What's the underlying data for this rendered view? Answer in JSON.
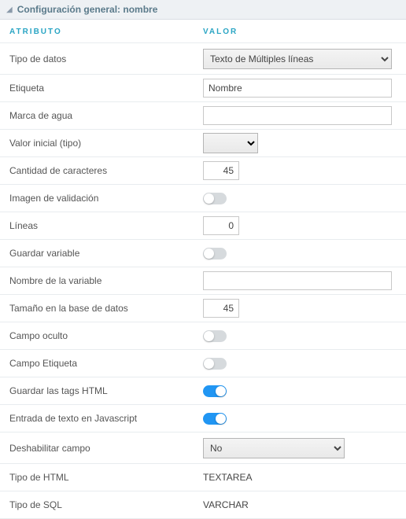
{
  "header": {
    "title": "Configuración general: nombre"
  },
  "columns": {
    "attr": "ATRIBUTO",
    "val": "VALOR"
  },
  "fields": {
    "data_type": {
      "label": "Tipo de datos",
      "value": "Texto de Múltiples líneas"
    },
    "label": {
      "label": "Etiqueta",
      "value": "Nombre"
    },
    "watermark": {
      "label": "Marca de agua",
      "value": ""
    },
    "initial_value": {
      "label": "Valor inicial (tipo)",
      "value": ""
    },
    "char_count": {
      "label": "Cantidad de caracteres",
      "value": "45"
    },
    "validation_img": {
      "label": "Imagen de validación",
      "on": false
    },
    "lines": {
      "label": "Líneas",
      "value": "0"
    },
    "save_var": {
      "label": "Guardar variable",
      "on": false
    },
    "var_name": {
      "label": "Nombre de la variable",
      "value": ""
    },
    "db_size": {
      "label": "Tamaño en la base de datos",
      "value": "45"
    },
    "hidden_field": {
      "label": "Campo oculto",
      "on": false
    },
    "label_field": {
      "label": "Campo Etiqueta",
      "on": false
    },
    "save_html_tags": {
      "label": "Guardar las tags HTML",
      "on": true
    },
    "js_text_input": {
      "label": "Entrada de texto en Javascript",
      "on": true
    },
    "disable_field": {
      "label": "Deshabilitar campo",
      "value": "No"
    },
    "html_type": {
      "label": "Tipo de HTML",
      "value": "TEXTAREA"
    },
    "sql_type": {
      "label": "Tipo de SQL",
      "value": "VARCHAR"
    }
  }
}
